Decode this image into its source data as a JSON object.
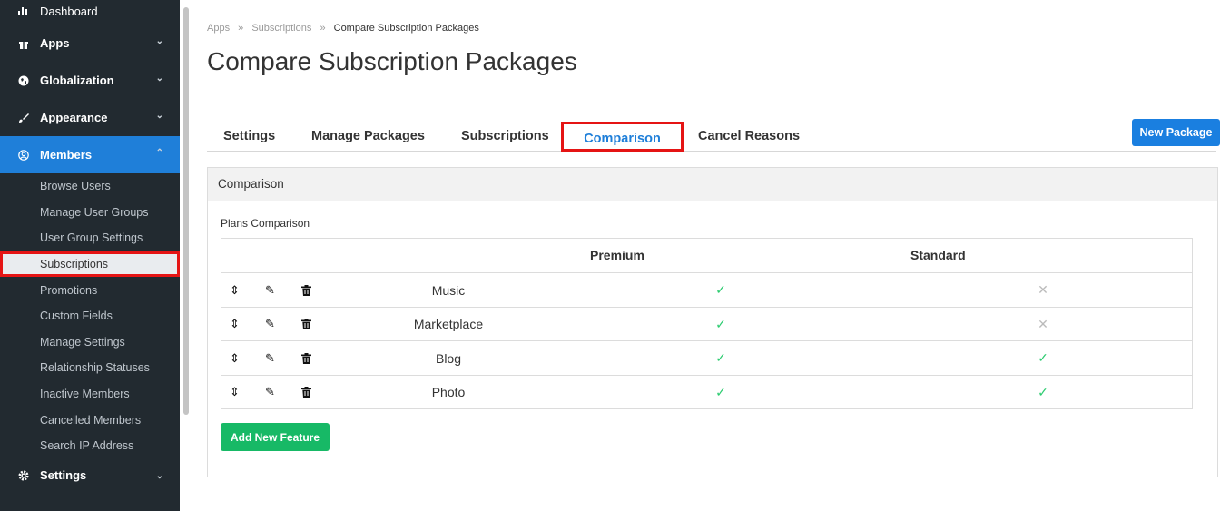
{
  "sidebar": {
    "dashboard": "Dashboard",
    "apps": "Apps",
    "globalization": "Globalization",
    "appearance": "Appearance",
    "members": "Members",
    "settings": "Settings",
    "members_items": [
      "Browse Users",
      "Manage User Groups",
      "User Group Settings",
      "Subscriptions",
      "Promotions",
      "Custom Fields",
      "Manage Settings",
      "Relationship Statuses",
      "Inactive Members",
      "Cancelled Members",
      "Search IP Address"
    ]
  },
  "breadcrumb": {
    "items": [
      "Apps",
      "Subscriptions"
    ],
    "current": "Compare Subscription Packages",
    "sep": "»"
  },
  "page_title": "Compare Subscription Packages",
  "tabs": [
    "Settings",
    "Manage Packages",
    "Subscriptions",
    "Comparison",
    "Cancel Reasons"
  ],
  "new_package": "New Package",
  "panel": {
    "title": "Comparison",
    "plans_label": "Plans Comparison"
  },
  "table": {
    "columns": [
      "Premium",
      "Standard"
    ],
    "rows": [
      {
        "feature": "Music",
        "premium": true,
        "standard": false
      },
      {
        "feature": "Marketplace",
        "premium": true,
        "standard": false
      },
      {
        "feature": "Blog",
        "premium": true,
        "standard": true
      },
      {
        "feature": "Photo",
        "premium": true,
        "standard": true
      }
    ]
  },
  "add_feature": "Add New Feature",
  "colors": {
    "sidebar_bg": "#222a30",
    "accent": "#1f7fd9",
    "success": "#17b966",
    "highlight": "#e51414"
  }
}
